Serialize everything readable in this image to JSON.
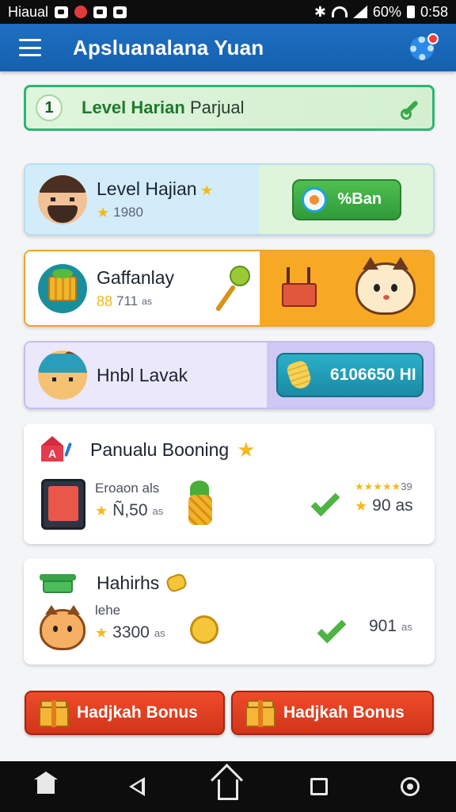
{
  "status_bar": {
    "carrier": "Hiaual",
    "battery": "60%",
    "time": "0:58"
  },
  "app_bar": {
    "title": "Apsluanalana Yuan"
  },
  "level_banner": {
    "number": "1",
    "title": "Level Harian",
    "subtitle": "Parjual"
  },
  "cards": [
    {
      "title": "Level Hajian",
      "value": "1980",
      "button_label": "%Ban"
    },
    {
      "title": "Gaffanlay",
      "value": "711",
      "value_prefix": "88",
      "unit": "as"
    },
    {
      "title": "Hnbl Lavak",
      "button_label": "6106650 HI"
    },
    {
      "title": "Panualu Booning",
      "label": "Eroaon als",
      "value": "Ñ,50",
      "unit": "as",
      "right_stars_text": "39",
      "right_value": "90",
      "right_unit": "as"
    },
    {
      "title": "Hahirhs",
      "label": "lehe",
      "value": "3300",
      "unit": "as",
      "right_value": "901",
      "right_unit": "as"
    }
  ],
  "bonus_buttons": [
    {
      "label": "Hadjkah Bonus"
    },
    {
      "label": "Hadjkah Bonus"
    }
  ],
  "colors": {
    "app_bar": "#1565c0",
    "level_border": "#2bb673",
    "bonus": "#e2401f",
    "accent_green": "#3aa84a"
  }
}
